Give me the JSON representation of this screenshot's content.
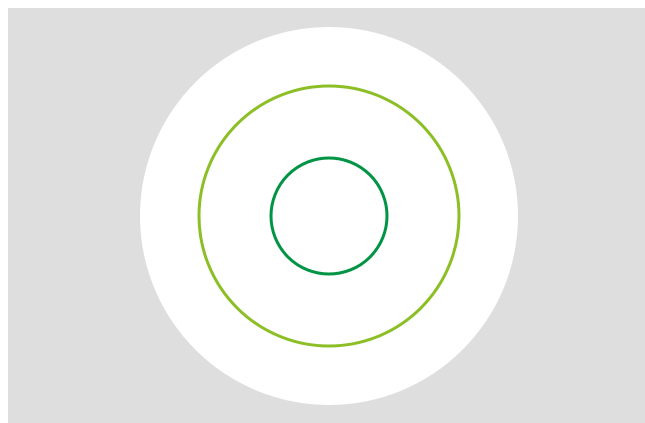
{
  "colors": {
    "page_background": "#ffffff",
    "panel_background": "#dedede",
    "outer_disc": "#ffffff",
    "middle_ring": "#8cbf26",
    "inner_ring": "#009444"
  },
  "shapes": [
    "outer-disc",
    "middle-ring",
    "inner-ring"
  ]
}
